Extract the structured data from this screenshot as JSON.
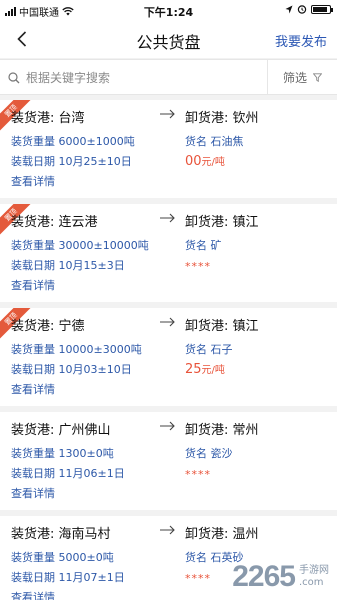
{
  "status_bar": {
    "carrier": "中国联通",
    "time": "下午1:24",
    "colors": {
      "text": "#111111"
    }
  },
  "nav": {
    "title": "公共货盘",
    "publish_label": "我要发布",
    "back_icon": "chevron-left-icon",
    "accent": "#2b57b4"
  },
  "search": {
    "placeholder": "根据关键字搜索",
    "value": "",
    "filter_label": "筛选",
    "icons": [
      "search-icon",
      "filter-icon"
    ]
  },
  "cargo_list": [
    {
      "pinned": true,
      "badge": "置顶",
      "from": "装货港: 台湾",
      "to": "卸货港: 钦州",
      "weight": "装货重量 6000±1000吨",
      "date": "装载日期 10月25±10日",
      "detail": "查看详情",
      "goods": "货名 石油焦",
      "price_value": "00",
      "price_unit": "元/吨",
      "price_masked": ""
    },
    {
      "pinned": true,
      "badge": "置顶",
      "from": "装货港: 连云港",
      "to": "卸货港: 镇江",
      "weight": "装货重量 30000±10000吨",
      "date": "装载日期 10月15±3日",
      "detail": "查看详情",
      "goods": "货名 矿",
      "price_value": "",
      "price_unit": "",
      "price_masked": "****"
    },
    {
      "pinned": true,
      "badge": "置顶",
      "from": "装货港: 宁德",
      "to": "卸货港: 镇江",
      "weight": "装货重量 10000±3000吨",
      "date": "装载日期 10月03±10日",
      "detail": "查看详情",
      "goods": "货名 石子",
      "price_value": "25",
      "price_unit": "元/吨",
      "price_masked": ""
    },
    {
      "pinned": false,
      "badge": "",
      "from": "装货港: 广州佛山",
      "to": "卸货港: 常州",
      "weight": "装货重量 1300±0吨",
      "date": "装载日期 11月06±1日",
      "detail": "查看详情",
      "goods": "货名 瓷沙",
      "price_value": "",
      "price_unit": "",
      "price_masked": "****"
    },
    {
      "pinned": false,
      "badge": "",
      "from": "装货港: 海南马村",
      "to": "卸货港: 温州",
      "weight": "装货重量 5000±0吨",
      "date": "装载日期 11月07±1日",
      "detail": "查看详情",
      "goods": "货名 石英砂",
      "price_value": "",
      "price_unit": "",
      "price_masked": "****"
    }
  ],
  "watermark": {
    "number": "2265",
    "line1": "手游网",
    "line2": ".com"
  },
  "colors": {
    "label_blue": "#2d58a8",
    "price_red": "#e8533a",
    "badge_red": "#e45a3b",
    "background": "#f2f2f2"
  }
}
